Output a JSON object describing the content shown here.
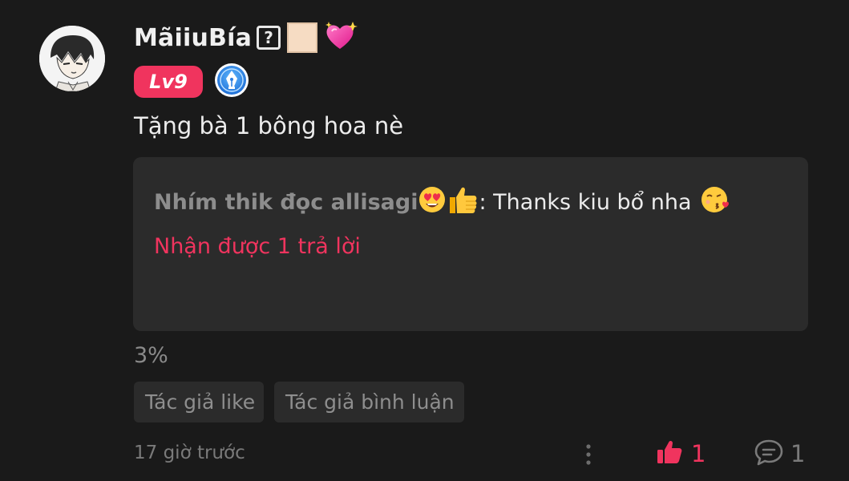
{
  "comment": {
    "username": "MãiiuBía",
    "level_badge": "Lv9",
    "text": "Tặng bà 1 bông hoa nè",
    "reply": {
      "author": "Nhím thik đọc allisagi",
      "content": ": Thanks kiu bổ nha",
      "reply_count": "Nhận được 1 trả lời"
    },
    "percent": "3%",
    "tags": [
      "Tác giả like",
      "Tác giả bình luận"
    ],
    "timestamp": "17 giờ trước",
    "like_count": "1",
    "reply_total": "1"
  },
  "icons": {
    "avatar": "anime-character-avatar",
    "unknown_glyph": "question-box-icon",
    "skin_tone": "skin-tone-box",
    "heart": "sparkling-heart-icon",
    "badge": "pen-nib-badge-icon",
    "heart_eyes": "heart-eyes-emoji",
    "thumbs_up": "thumbs-up-emoji",
    "kiss": "kissing-face-emoji",
    "more": "more-vertical-icon",
    "like": "thumbs-up-icon",
    "comment": "comment-bubble-icon"
  },
  "colors": {
    "background": "#1a1a1a",
    "card": "#2b2b2b",
    "accent": "#f0345e",
    "muted": "#7a7a7a"
  }
}
